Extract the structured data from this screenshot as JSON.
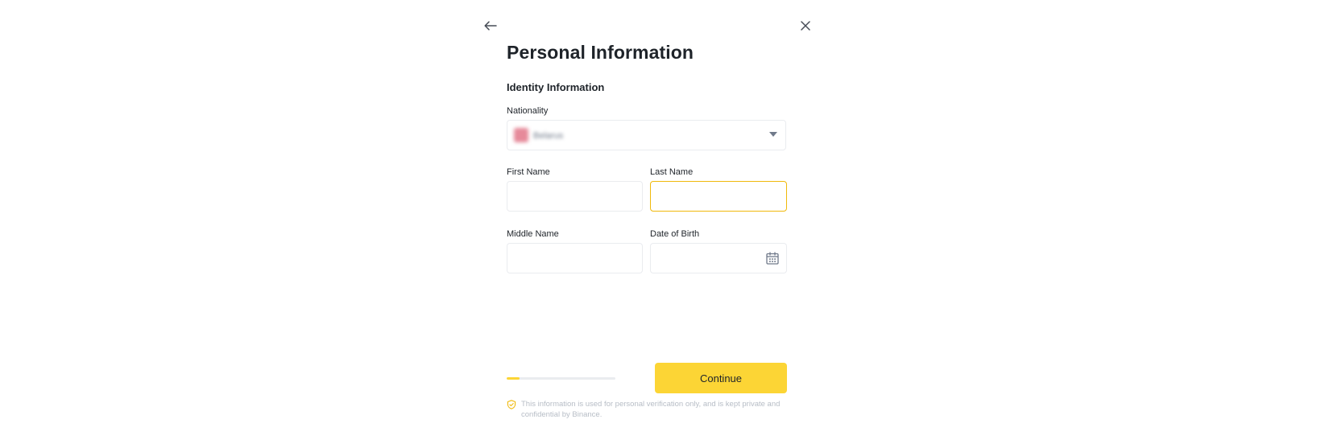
{
  "header": {
    "back_icon": "arrow-left-icon",
    "close_icon": "close-icon"
  },
  "title": "Personal Information",
  "section_title": "Identity Information",
  "fields": {
    "nationality": {
      "label": "Nationality",
      "value": "Belarus",
      "flag_icon": "country-flag-icon"
    },
    "first_name": {
      "label": "First Name",
      "value": ""
    },
    "last_name": {
      "label": "Last Name",
      "value": "",
      "focused": true
    },
    "middle_name": {
      "label": "Middle Name",
      "value": ""
    },
    "date_of_birth": {
      "label": "Date of Birth",
      "value": "",
      "icon": "calendar-icon"
    }
  },
  "progress": {
    "fraction": 0.12
  },
  "continue_label": "Continue",
  "privacy_note": "This information is used for personal verification only, and is kept private and confidential by Binance.",
  "colors": {
    "accent": "#fcd535",
    "focus_border": "#f0b90b",
    "border": "#eaecef",
    "text": "#1e2329",
    "muted_text": "#b7bdc6"
  }
}
